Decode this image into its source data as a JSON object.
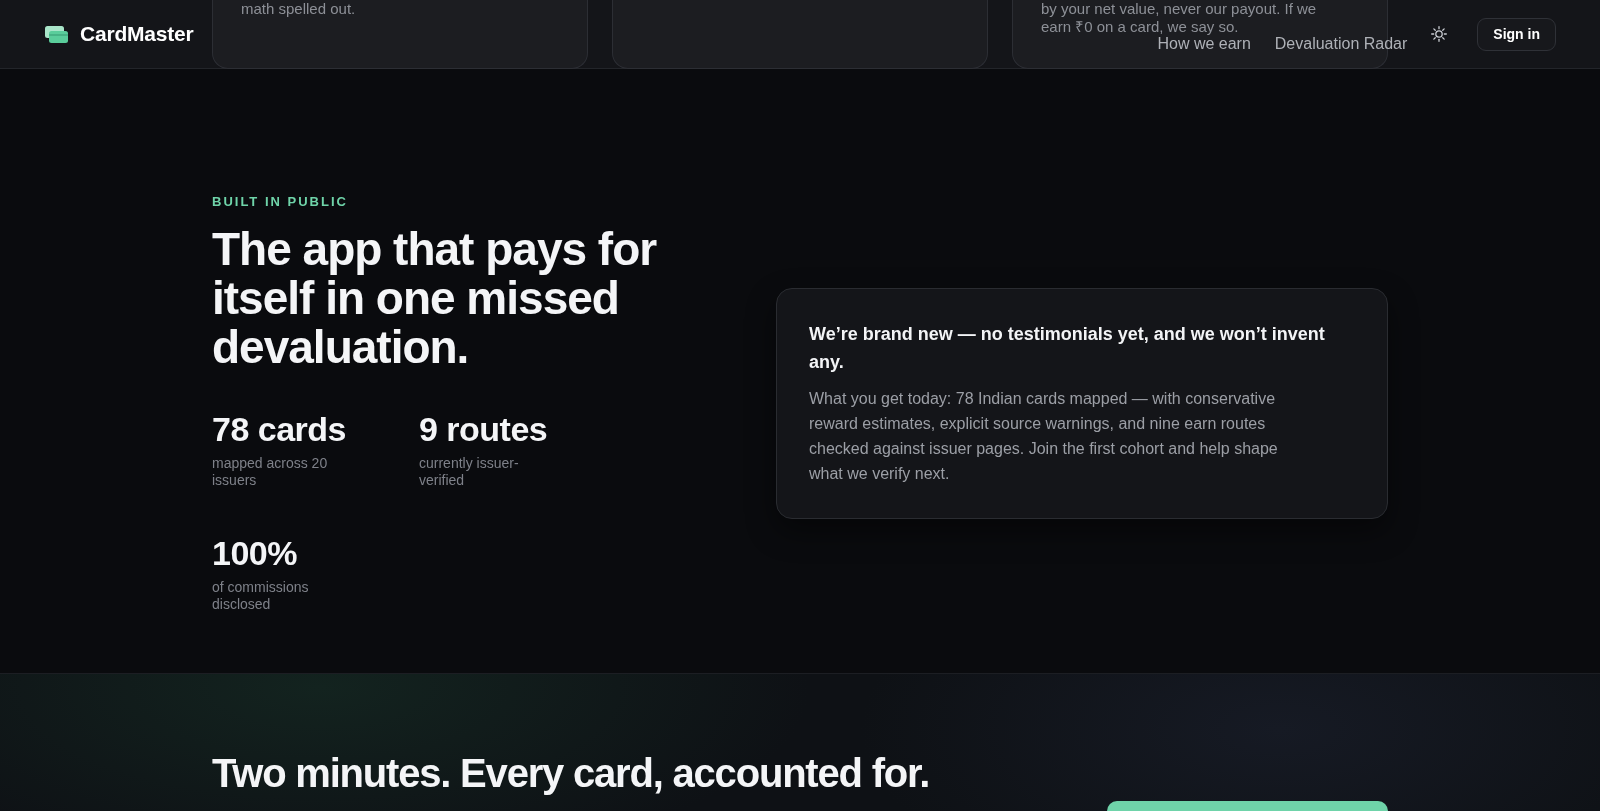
{
  "header": {
    "logo": "CardMaster",
    "nav": [
      {
        "label": "How we earn"
      },
      {
        "label": "Devaluation Radar"
      }
    ],
    "sign_in": "Sign in"
  },
  "scrolled_cards": [
    {
      "kind": "text",
      "text": "math spelled out."
    },
    {
      "kind": "blank"
    },
    {
      "kind": "text",
      "text": "by your net value, never our payout. If we earn ₹0 on a card, we say so."
    }
  ],
  "built_in_public": {
    "eyebrow": "BUILT IN PUBLIC",
    "heading": "The app that pays for itself in one missed devaluation.",
    "stats": [
      {
        "value": "78 cards",
        "label": "mapped across 20 issuers"
      },
      {
        "value": "9 routes",
        "label": "currently issuer-verified"
      },
      {
        "value": "100%",
        "label": "of commissions disclosed"
      }
    ],
    "notice": {
      "title": "We’re brand new — no testimonials yet, and we won’t invent any.",
      "body": "What you get today: 78 Indian cards mapped — with conservative reward estimates, explicit source warnings, and nine earn routes checked against issuer pages. Join the first cohort and help shape what we verify next."
    }
  },
  "cta": {
    "heading": "Two minutes. Every card, accounted for."
  }
}
